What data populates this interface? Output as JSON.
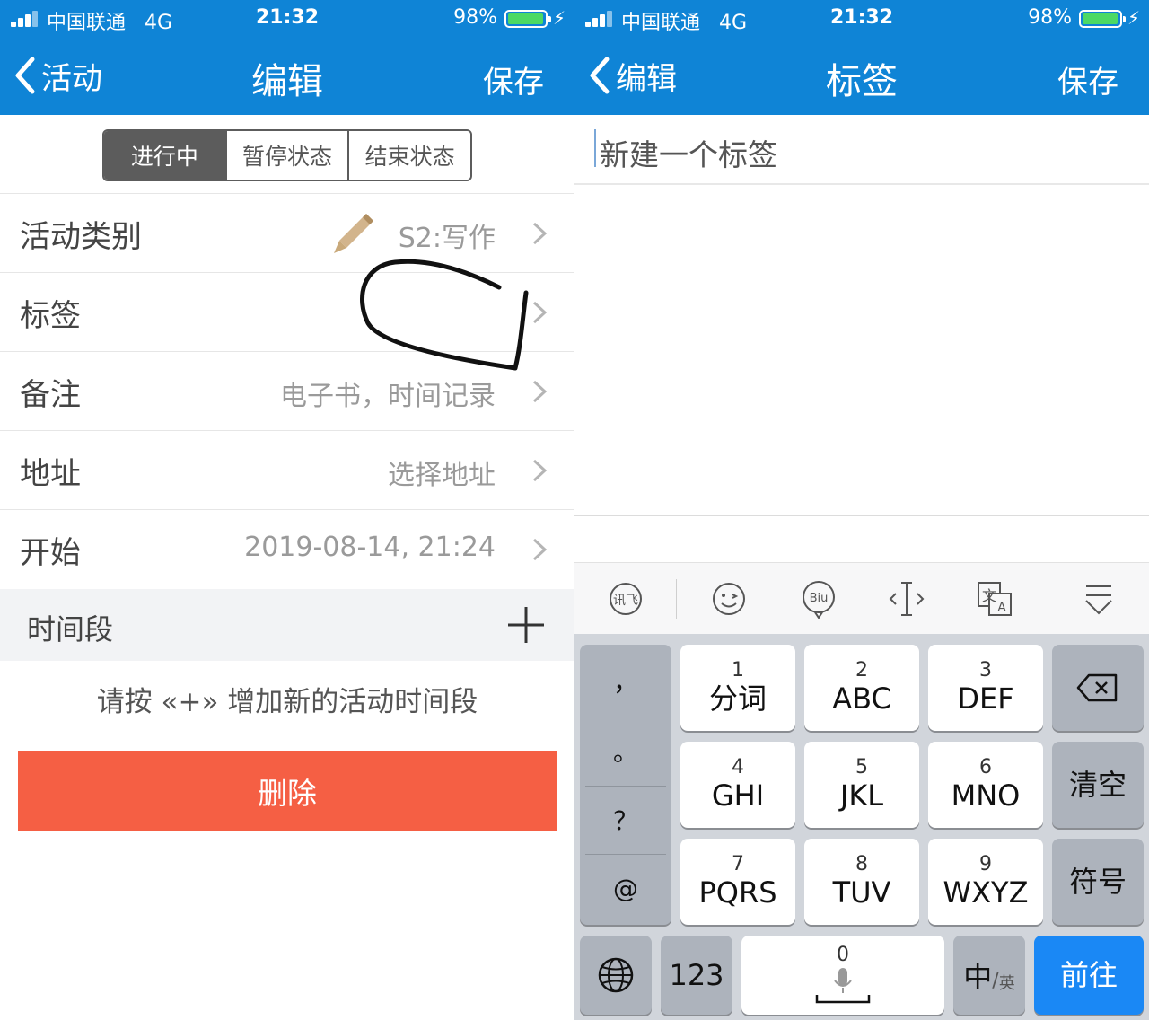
{
  "status_bar": {
    "carrier": "中国联通",
    "network": "4G",
    "time": "21:32",
    "battery": "98%",
    "battery_level": 0.98
  },
  "left": {
    "nav": {
      "back_label": "活动",
      "title": "编辑",
      "save_label": "保存"
    },
    "segments": [
      {
        "label": "进行中",
        "active": true
      },
      {
        "label": "暂停状态",
        "active": false
      },
      {
        "label": "结束状态",
        "active": false
      }
    ],
    "rows": {
      "category": {
        "label": "活动类别",
        "value": "S2:写作",
        "icon": "pencil-icon"
      },
      "tags": {
        "label": "标签",
        "value": ""
      },
      "notes": {
        "label": "备注",
        "value": "电子书，时间记录"
      },
      "address": {
        "label": "地址",
        "value": "选择地址"
      },
      "start": {
        "label": "开始",
        "value": "2019-08-14, 21:24"
      }
    },
    "section": {
      "label": "时间段",
      "add_icon": "plus-icon"
    },
    "hint": "请按 «+» 增加新的活动时间段",
    "delete_label": "删除",
    "colors": {
      "header": "#0f84d6",
      "delete": "#f55f44",
      "segment_active": "#5c5c5c"
    }
  },
  "right": {
    "nav": {
      "back_label": "编辑",
      "title": "标签",
      "save_label": "保存"
    },
    "input": {
      "placeholder": "新建一个标签"
    },
    "toolbar_icons": [
      "xunfei-icon",
      "emoji-icon",
      "biu-icon",
      "cursor-icon",
      "translate-icon",
      "collapse-keyboard-icon"
    ],
    "keyboard": {
      "punctuation": [
        "，",
        "。",
        "？",
        "@"
      ],
      "keys": [
        {
          "num": "1",
          "label": "分词"
        },
        {
          "num": "2",
          "label": "ABC"
        },
        {
          "num": "3",
          "label": "DEF"
        },
        {
          "num": "4",
          "label": "GHI"
        },
        {
          "num": "5",
          "label": "JKL"
        },
        {
          "num": "6",
          "label": "MNO"
        },
        {
          "num": "7",
          "label": "PQRS"
        },
        {
          "num": "8",
          "label": "TUV"
        },
        {
          "num": "9",
          "label": "WXYZ"
        }
      ],
      "clear": "清空",
      "symbols": "符号",
      "num_switch": "123",
      "space_num": "0",
      "lang_main": "中",
      "lang_sub": "英",
      "go": "前往",
      "colors": {
        "go": "#1a88f5",
        "keyboard_bg": "#d1d5db"
      }
    }
  }
}
